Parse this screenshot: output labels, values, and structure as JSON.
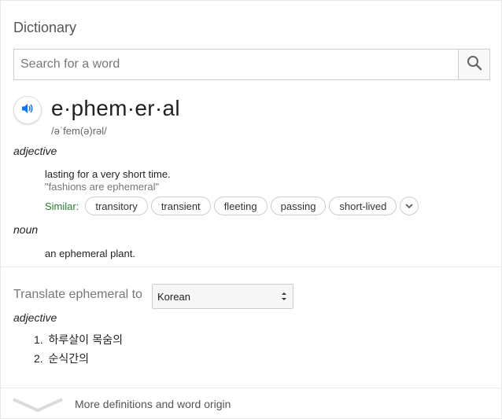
{
  "header": {
    "title": "Dictionary"
  },
  "search": {
    "placeholder": "Search for a word",
    "value": ""
  },
  "entry": {
    "headword": "e·phem·er·al",
    "phonetic": "/əˈfem(ə)rəl/",
    "senses": [
      {
        "pos": "adjective",
        "definition": "lasting for a very short time.",
        "example": "\"fashions are ephemeral\"",
        "similar_label": "Similar:",
        "similar": [
          "transitory",
          "transient",
          "fleeting",
          "passing",
          "short-lived"
        ]
      },
      {
        "pos": "noun",
        "definition": "an ephemeral plant."
      }
    ]
  },
  "translate": {
    "label": "Translate ephemeral to",
    "language": "Korean",
    "pos": "adjective",
    "items": [
      {
        "num": "1.",
        "text": "하루살이 목숨의"
      },
      {
        "num": "2.",
        "text": "순식간의"
      }
    ]
  },
  "footer": {
    "more_label": "More definitions and word origin"
  },
  "icons": {
    "search": "search-icon",
    "speaker": "speaker-icon",
    "more_similar": "chevron-down-icon",
    "select": "select-arrows-icon",
    "expand": "chevron-down-icon"
  },
  "colors": {
    "accent_blue": "#1a73e8",
    "similar_green": "#2a7d2e",
    "muted_text": "#777777"
  }
}
